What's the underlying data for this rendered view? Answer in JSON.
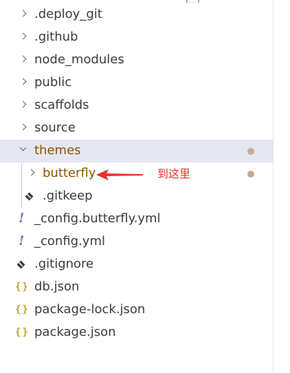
{
  "top_partial_text": "(...)",
  "tree": {
    "items": [
      {
        "label": ".deploy_git",
        "type": "folder",
        "state": "collapsed"
      },
      {
        "label": ".github",
        "type": "folder",
        "state": "collapsed"
      },
      {
        "label": "node_modules",
        "type": "folder",
        "state": "collapsed"
      },
      {
        "label": "public",
        "type": "folder",
        "state": "collapsed"
      },
      {
        "label": "scaffolds",
        "type": "folder",
        "state": "collapsed"
      },
      {
        "label": "source",
        "type": "folder",
        "state": "collapsed"
      },
      {
        "label": "themes",
        "type": "folder",
        "state": "expanded",
        "selected": true,
        "modified": true
      },
      {
        "label": "butterfly",
        "type": "folder",
        "state": "collapsed",
        "modified": true
      },
      {
        "label": ".gitkeep",
        "type": "file",
        "icon": "git-diamond-icon"
      },
      {
        "label": "_config.butterfly.yml",
        "type": "file",
        "icon": "yaml-exclamation-icon"
      },
      {
        "label": "_config.yml",
        "type": "file",
        "icon": "yaml-exclamation-icon"
      },
      {
        "label": ".gitignore",
        "type": "file",
        "icon": "git-diamond-icon"
      },
      {
        "label": "db.json",
        "type": "file",
        "icon": "json-braces-icon"
      },
      {
        "label": "package-lock.json",
        "type": "file",
        "icon": "json-braces-icon"
      },
      {
        "label": "package.json",
        "type": "file",
        "icon": "json-braces-icon"
      }
    ]
  },
  "annotation": {
    "text": "到这里",
    "color": "#e8322e"
  },
  "icons": {
    "json_glyph": "{}",
    "yaml_glyph": "!"
  },
  "colors": {
    "selected_row": "#e4e6f1",
    "modified_text": "#895503",
    "modified_dot": "#c5ac8f",
    "default_text": "#3b3b3b"
  }
}
